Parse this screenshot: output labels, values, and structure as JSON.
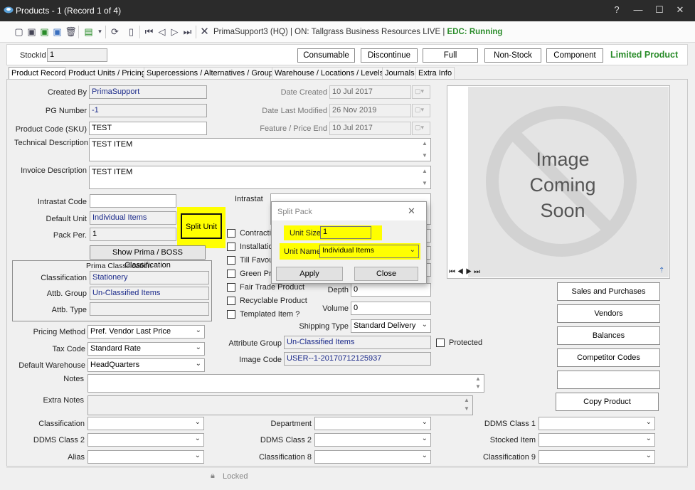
{
  "window": {
    "title": "Products - 1  (Record 1 of 4)",
    "help": "?",
    "minimize": "—",
    "maximize": "☐",
    "close": "✕"
  },
  "toolbar": {
    "connection_prefix": "PrimaSupport3  (HQ) | ON: Tallgrass Business Resources  LIVE | ",
    "edc_status": "EDC: Running"
  },
  "stock": {
    "label": "StockId",
    "value": "1"
  },
  "product_types": [
    "Consumable",
    "Discontinue",
    "Full",
    "Non-Stock",
    "Component"
  ],
  "limited_product": "Limited Product",
  "tabs": [
    "Product Record",
    "Product Units / Pricing",
    "Supercessions / Alternatives / Groups",
    "Warehouse / Locations / Levels",
    "Journals",
    "Extra Info"
  ],
  "form": {
    "created_by_label": "Created By",
    "created_by": "PrimaSupport",
    "pg_number_label": "PG Number",
    "pg_number": "-1",
    "product_code_label": "Product Code (SKU)",
    "product_code": "TEST",
    "tech_desc_label": "Technical Description",
    "tech_desc": "TEST ITEM",
    "invoice_desc_label": "Invoice Description",
    "invoice_desc": "TEST ITEM",
    "intrastat_code_label": "Intrastat Code",
    "intrastat_code": "",
    "default_unit_label": "Default Unit",
    "default_unit": "Individual Items",
    "pack_per_label": "Pack Per.",
    "pack_per": "1",
    "split_unit_button": "Split Unit",
    "show_prima_button": "Show Prima / BOSS Classification",
    "prima_classification_title": "Prima Classification",
    "classification_label": "Classification",
    "classification": "Stationery",
    "attb_group_label": "Attb. Group",
    "attb_group": "Un-Classified Items",
    "attb_type_label": "Attb. Type",
    "attb_type": "",
    "pricing_method_label": "Pricing Method",
    "pricing_method": "Pref. Vendor Last Price",
    "tax_code_label": "Tax Code",
    "tax_code": "Standard Rate",
    "default_warehouse_label": "Default Warehouse",
    "default_warehouse": "HeadQuarters",
    "notes_label": "Notes",
    "notes": "",
    "extra_notes_label": "Extra Notes",
    "extra_notes": "",
    "date_created_label": "Date Created",
    "date_created": "10 Jul 2017",
    "date_modified_label": "Date Last Modified",
    "date_modified": "26 Nov 2019",
    "feature_price_end_label": "Feature / Price End",
    "feature_price_end": "10 Jul 2017",
    "intrastat_label": "Intrastat",
    "checkboxes": [
      "Contractib",
      "Installation",
      "Till Favour",
      "Green Pro",
      "Fair Trade Product",
      "Recyclable Product",
      "Templated Item ?"
    ],
    "depth_label": "Depth",
    "depth": "0",
    "volume_label": "Volume",
    "volume": "0",
    "shipping_type_label": "Shipping Type",
    "shipping_type": "Standard Delivery",
    "protected_label": "Protected",
    "attribute_group_label": "Attribute Group",
    "attribute_group": "Un-Classified Items",
    "image_code_label": "Image Code",
    "image_code": "USER--1-20170712125937"
  },
  "bottom_fields": {
    "classification_label": "Classification",
    "ddms_class2_label": "DDMS Class 2",
    "alias_label": "Alias",
    "department_label": "Department",
    "ddms_class2b_label": "DDMS Class 2",
    "classification8_label": "Classification 8",
    "ddms_class1_label": "DDMS Class 1",
    "stocked_item_label": "Stocked Item",
    "classification9_label": "Classification 9"
  },
  "image_panel": {
    "placeholder_lines": [
      "Image",
      "Coming",
      "Soon"
    ],
    "nav": "⏮ ◀ ▶ ⏭"
  },
  "side_buttons": [
    "Sales and Purchases",
    "Vendors",
    "Balances",
    "Competitor Codes",
    "",
    "Copy Product"
  ],
  "status": {
    "locked": "Locked"
  },
  "dialog": {
    "title": "Split Pack",
    "unit_size_label": "Unit Size",
    "unit_size": "1",
    "unit_name_label": "Unit Name",
    "unit_name": "Individual Items",
    "apply": "Apply",
    "close": "Close"
  },
  "colors": {
    "highlight": "#ffff00",
    "accent_green": "#2a8c2a",
    "value_blue": "#1b2a8a"
  }
}
